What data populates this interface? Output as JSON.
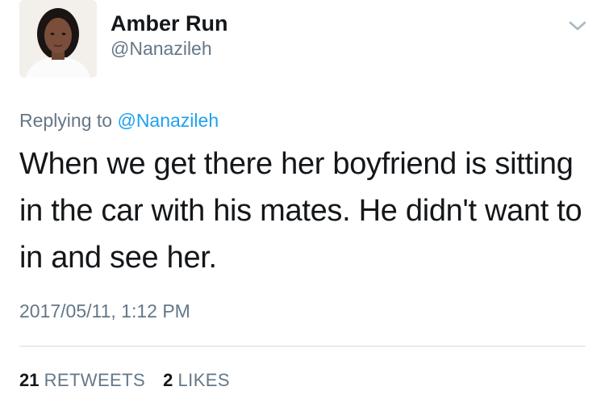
{
  "author": {
    "name": "Amber Run",
    "handle": "@Nanazileh"
  },
  "reply": {
    "prefix": "Replying to ",
    "mention": "@Nanazileh"
  },
  "tweet": {
    "text": "When we get there her boyfriend is sitting in the car with his mates. He didn't want to in and see her.",
    "timestamp": "2017/05/11, 1:12 PM"
  },
  "stats": {
    "retweets_count": "21",
    "retweets_label": "RETWEETS",
    "likes_count": "2",
    "likes_label": "LIKES"
  },
  "icons": {
    "menu": "chevron-down-icon"
  },
  "colors": {
    "text": "#14171a",
    "secondary": "#657786",
    "link": "#1da1f2",
    "divider": "#d8dde2"
  }
}
